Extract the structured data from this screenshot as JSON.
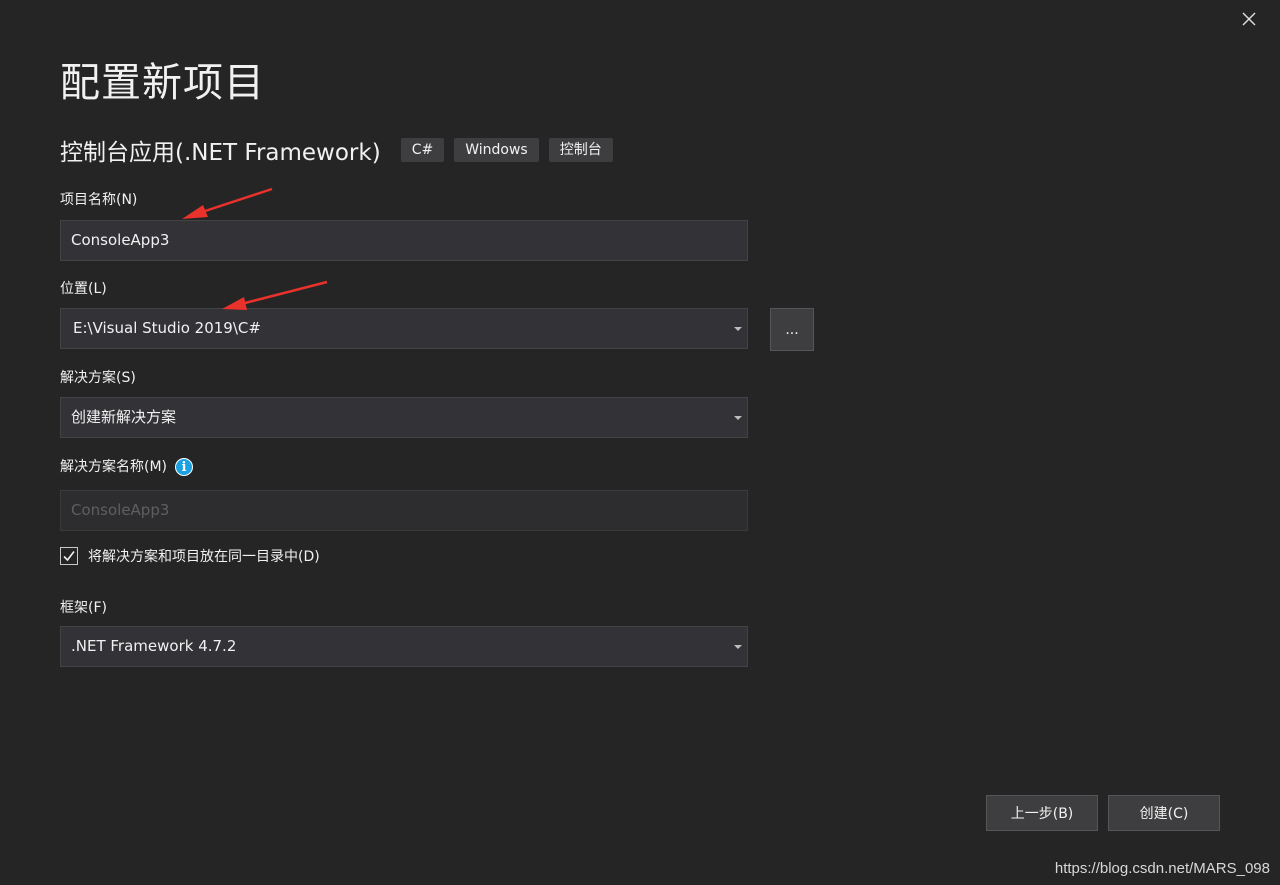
{
  "dialog": {
    "title": "配置新项目",
    "close_icon": "close-icon"
  },
  "template": {
    "name": "控制台应用(.NET Framework)",
    "tags": [
      "C#",
      "Windows",
      "控制台"
    ]
  },
  "project_name": {
    "label": "项目名称(N)",
    "value": "ConsoleApp3"
  },
  "location": {
    "label": "位置(L)",
    "value": "E:\\Visual Studio 2019\\C#",
    "browse_label": "..."
  },
  "solution": {
    "label": "解决方案(S)",
    "value": "创建新解决方案"
  },
  "solution_name": {
    "label": "解决方案名称(M)",
    "value": "ConsoleApp3",
    "info_icon": "info-icon"
  },
  "same_directory": {
    "label": "将解决方案和项目放在同一目录中(D)",
    "checked": true
  },
  "framework": {
    "label": "框架(F)",
    "value": ".NET Framework 4.7.2"
  },
  "buttons": {
    "back": "上一步(B)",
    "create": "创建(C)"
  },
  "watermark": "https://blog.csdn.net/MARS_098",
  "colors": {
    "background": "#252526",
    "field": "#333337",
    "annotation_arrow": "#e8322b",
    "info": "#1ba1e2"
  }
}
